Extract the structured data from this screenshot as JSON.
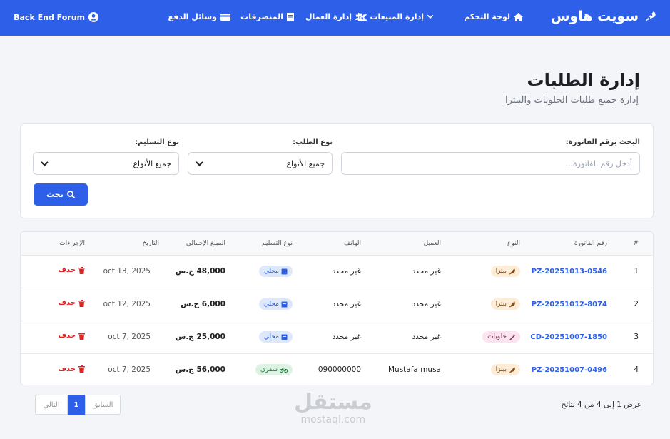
{
  "nav": {
    "brand": "سويت هاوس",
    "dashboard": "لوحة التحكم",
    "sales": "إدارة المبيعات",
    "workers": "إدارة العمال",
    "expenses": "المنصرفات",
    "payment": "وسائل الدفع",
    "user": "Back End Forum"
  },
  "header": {
    "title": "إدارة الطلبات",
    "subtitle": "إدارة جميع طلبات الحلويات والبيتزا"
  },
  "filters": {
    "invoice_label": "البحث برقم الفاتورة:",
    "invoice_placeholder": "أدخل رقم الفاتورة...",
    "type_label": "نوع الطلب:",
    "type_value": "جميع الأنواع",
    "delivery_label": "نوع التسليم:",
    "delivery_value": "جميع الأنواع",
    "search_button": "بحث"
  },
  "table": {
    "headers": [
      "#",
      "رقم الفاتورة",
      "النوع",
      "العميل",
      "الهاتف",
      "نوع التسليم",
      "المبلغ الإجمالي",
      "التاريخ",
      "الإجراءات"
    ],
    "rows": [
      {
        "num": "1",
        "invoice": "PZ-20251013-0546",
        "type": "بيتزا",
        "type_kind": "pizza",
        "customer": "غير محدد",
        "phone": "غير محدد",
        "delivery": "محلي",
        "delivery_kind": "local",
        "amount": "48,000 ج.س",
        "date": "oct 13, 2025",
        "action": "حذف"
      },
      {
        "num": "2",
        "invoice": "PZ-20251012-8074",
        "type": "بيتزا",
        "type_kind": "pizza",
        "customer": "غير محدد",
        "phone": "غير محدد",
        "delivery": "محلي",
        "delivery_kind": "local",
        "amount": "6,000 ج.س",
        "date": "oct 12, 2025",
        "action": "حذف"
      },
      {
        "num": "3",
        "invoice": "CD-20251007-1850",
        "type": "حلويات",
        "type_kind": "sweet",
        "customer": "غير محدد",
        "phone": "غير محدد",
        "delivery": "محلي",
        "delivery_kind": "local",
        "amount": "25,000 ج.س",
        "date": "oct 7, 2025",
        "action": "حذف"
      },
      {
        "num": "4",
        "invoice": "PZ-20251007-0496",
        "type": "بيتزا",
        "type_kind": "pizza",
        "customer": "Mustafa musa",
        "phone": "090000000",
        "delivery": "سفري",
        "delivery_kind": "travel",
        "amount": "56,000 ج.س",
        "date": "oct 7, 2025",
        "action": "حذف"
      }
    ]
  },
  "pagination": {
    "info": "عرض 1 إلى 4 من 4 نتائج",
    "prev": "السابق",
    "page": "1",
    "next": "التالي"
  },
  "watermark": {
    "ar": "مستقل",
    "en": "mostaql.com"
  },
  "colors": {
    "primary": "#2d5fe8",
    "danger": "#e02424"
  }
}
